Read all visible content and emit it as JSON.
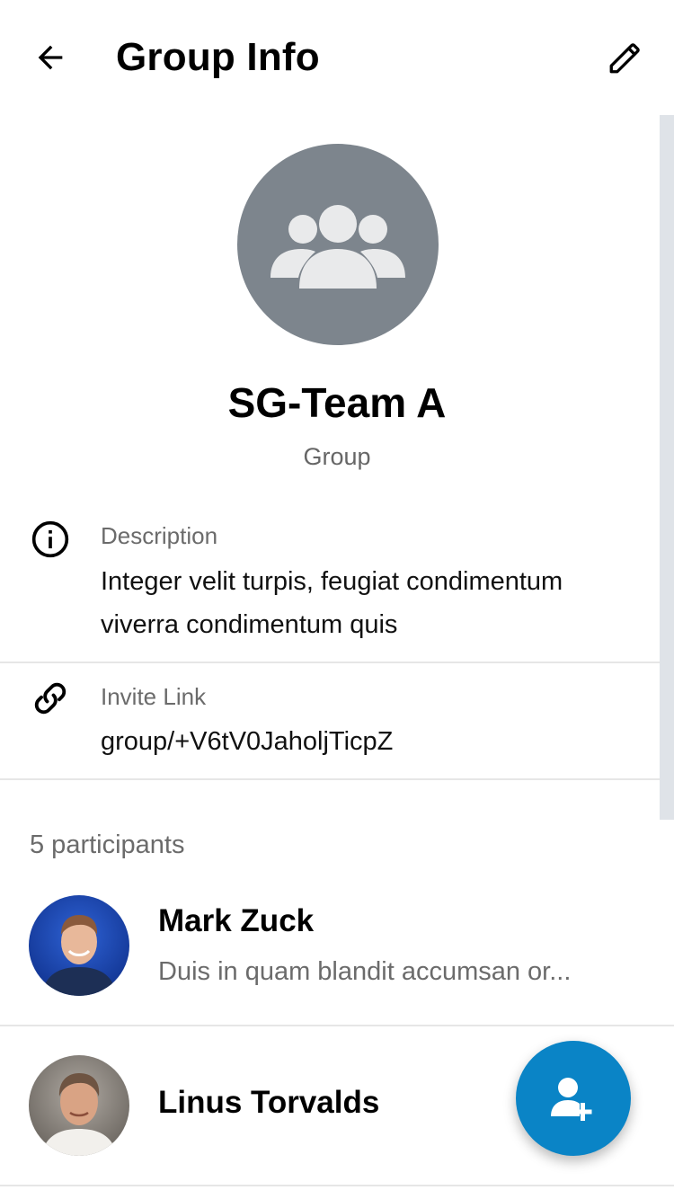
{
  "header": {
    "title": "Group Info",
    "back_icon": "arrow-left-icon",
    "edit_icon": "pencil-icon"
  },
  "group": {
    "avatar_icon": "group-icon",
    "name": "SG-Team A",
    "type": "Group"
  },
  "description": {
    "icon": "info-icon",
    "label": "Description",
    "value_line1": "Integer velit turpis, feugiat condimentum",
    "value_line2": "viverra condimentum quis"
  },
  "invite": {
    "icon": "link-icon",
    "label": "Invite Link",
    "value": "group/+V6tV0JaholjTicpZ"
  },
  "participants": {
    "count_label": "5 participants",
    "items": [
      {
        "name": "Mark Zuck",
        "status": "Duis in quam blandit accumsan or..."
      },
      {
        "name": "Linus Torvalds",
        "status": ""
      }
    ]
  },
  "fab": {
    "icon": "add-user-icon"
  },
  "colors": {
    "accent": "#0a84c6",
    "avatar_bg": "#7d858d",
    "secondary_text": "#6b6b6b"
  }
}
